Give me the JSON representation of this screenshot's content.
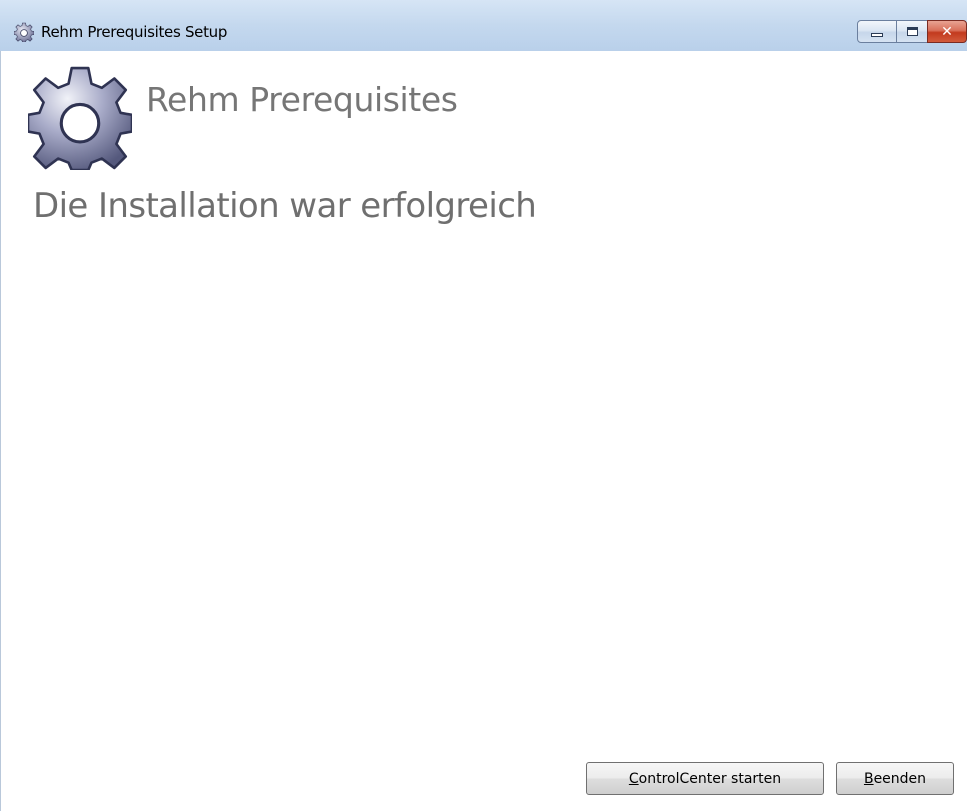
{
  "window": {
    "title": "Rehm Prerequisites Setup",
    "icon": "gear-icon",
    "controls": {
      "minimize_icon": "minimize-icon",
      "maximize_icon": "maximize-icon",
      "close_label": "✕"
    }
  },
  "app": {
    "logo_icon": "gear-icon",
    "name": "Rehm Prerequisites"
  },
  "status": {
    "message": "Die Installation war erfolgreich"
  },
  "buttons": {
    "controlcenter": {
      "mnemonic": "C",
      "rest": "ontrolCenter starten"
    },
    "exit": {
      "mnemonic": "B",
      "rest": "eenden"
    }
  },
  "colors": {
    "titlebar": "#c4d8ee",
    "heading_text": "#767676",
    "close_button": "#c23a1e"
  }
}
